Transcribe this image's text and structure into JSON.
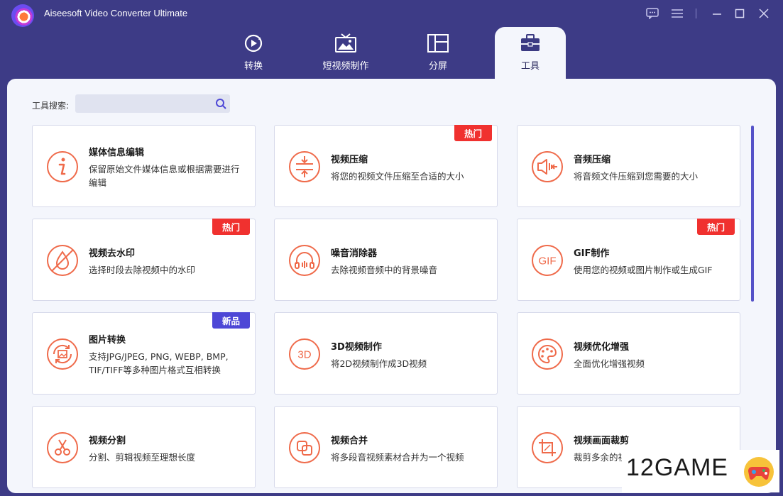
{
  "app": {
    "title": "Aiseesoft Video Converter Ultimate"
  },
  "window_controls": [
    "feedback-icon",
    "menu-icon",
    "minimize-icon",
    "maximize-icon",
    "close-icon"
  ],
  "tabs": [
    {
      "label": "转换",
      "icon": "convert-icon"
    },
    {
      "label": "短视频制作",
      "icon": "mv-icon"
    },
    {
      "label": "分屏",
      "icon": "collage-icon"
    },
    {
      "label": "工具",
      "icon": "toolbox-icon",
      "active": true
    }
  ],
  "search": {
    "label": "工具搜索:",
    "value": "",
    "placeholder": ""
  },
  "tools": [
    {
      "title": "媒体信息编辑",
      "desc": "保留原始文件媒体信息或根据需要进行编辑",
      "icon": "info-icon",
      "badge": ""
    },
    {
      "title": "视频压缩",
      "desc": "将您的视频文件压缩至合适的大小",
      "icon": "compress-icon",
      "badge": "热门"
    },
    {
      "title": "音频压缩",
      "desc": "将音频文件压缩到您需要的大小",
      "icon": "audio-compress-icon",
      "badge": ""
    },
    {
      "title": "视频去水印",
      "desc": "选择时段去除视频中的水印",
      "icon": "watermark-remove-icon",
      "badge": "热门"
    },
    {
      "title": "噪音消除器",
      "desc": "去除视频音频中的背景噪音",
      "icon": "headphones-icon",
      "badge": ""
    },
    {
      "title": "GIF制作",
      "desc": "使用您的视频或图片制作或生成GIF",
      "icon": "gif-icon",
      "badge": "热门"
    },
    {
      "title": "图片转换",
      "desc": "支持JPG/JPEG, PNG, WEBP, BMP, TIF/TIFF等多种图片格式互相转换",
      "icon": "image-convert-icon",
      "badge": "新品"
    },
    {
      "title": "3D视频制作",
      "desc": "将2D视频制作成3D视频",
      "icon": "3d-icon",
      "badge": ""
    },
    {
      "title": "视频优化增强",
      "desc": "全面优化增强视频",
      "icon": "palette-icon",
      "badge": ""
    },
    {
      "title": "视频分割",
      "desc": "分割、剪辑视频至理想长度",
      "icon": "scissors-icon",
      "badge": ""
    },
    {
      "title": "视频合并",
      "desc": "将多段音视频素材合并为一个视频",
      "icon": "merge-icon",
      "badge": ""
    },
    {
      "title": "视频画面裁剪",
      "desc": "裁剪多余的视",
      "icon": "crop-icon",
      "badge": ""
    }
  ],
  "watermark": {
    "text": "12GAME"
  },
  "colors": {
    "accent": "#ef6a4a",
    "hot_badge": "#f0312f",
    "new_badge": "#4d47d6",
    "header_bg": "#3d3b86",
    "panel_bg": "#f4f6fc"
  }
}
